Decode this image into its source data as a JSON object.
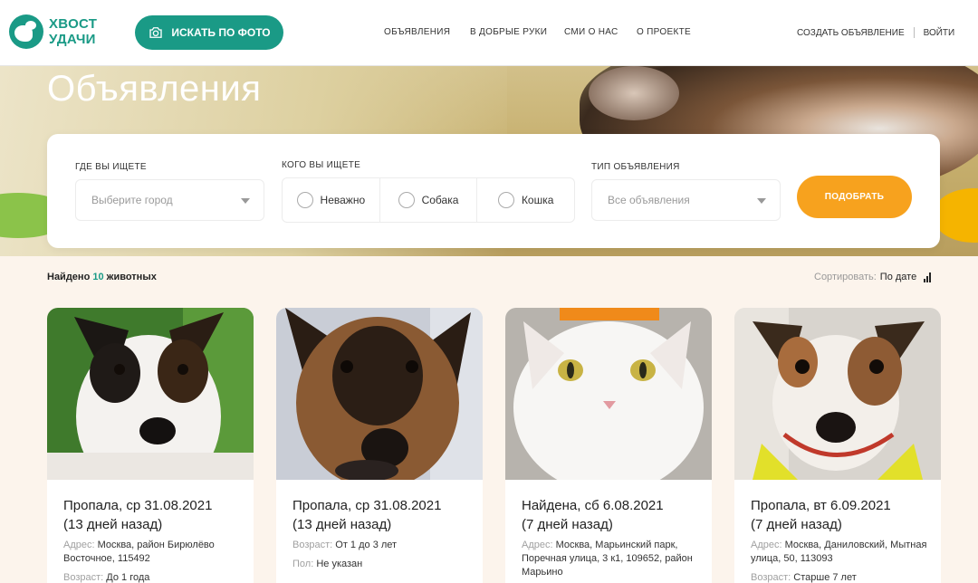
{
  "header": {
    "logo_line1": "ХВОСТ",
    "logo_line2": "УДАЧИ",
    "photo_button": "ИСКАТЬ ПО ФОТО",
    "nav": [
      "ОБЪЯВЛЕНИЯ",
      "В ДОБРЫЕ РУКИ",
      "СМИ О НАС",
      "О ПРОЕКТЕ"
    ],
    "create_ad": "СОЗДАТЬ ОБЪЯВЛЕНИЕ",
    "login": "ВОЙТИ"
  },
  "hero": {
    "title": "Объявления"
  },
  "filter": {
    "where_label": "ГДЕ ВЫ ИЩЕТЕ",
    "city_placeholder": "Выберите город",
    "who_label": "КОГО ВЫ ИЩЕТЕ",
    "who_options": [
      "Неважно",
      "Собака",
      "Кошка"
    ],
    "type_label": "ТИП ОБЪЯВЛЕНИЯ",
    "type_value": "Все объявления",
    "submit": "ПОДОБРАТЬ"
  },
  "results": {
    "found_prefix": "Найдено",
    "found_count": "10",
    "found_suffix": "животных",
    "sort_label": "Сортировать:",
    "sort_value": "По дате"
  },
  "cards": [
    {
      "title_line1": "Пропала, ср 31.08.2021",
      "title_line2": "(13 дней назад)",
      "rows": [
        {
          "key": "Адрес:",
          "value": "Москва, район Бирюлёво Восточное, 115492"
        },
        {
          "key": "Возраст:",
          "value": "До 1 года"
        }
      ]
    },
    {
      "title_line1": "Пропала, ср 31.08.2021",
      "title_line2": "(13 дней назад)",
      "rows": [
        {
          "key": "Возраст:",
          "value": "От 1 до 3 лет"
        },
        {
          "key": "Пол:",
          "value": "Не указан"
        }
      ]
    },
    {
      "title_line1": "Найдена, сб 6.08.2021",
      "title_line2": "(7 дней назад)",
      "rows": [
        {
          "key": "Адрес:",
          "value": "Москва, Марьинский парк, Поречная улица, 3 к1, 109652, район Марьино"
        }
      ]
    },
    {
      "title_line1": "Пропала, вт 6.09.2021",
      "title_line2": "(7 дней назад)",
      "rows": [
        {
          "key": "Адрес:",
          "value": "Москва, Даниловский, Мытная улица, 50, 113093"
        },
        {
          "key": "Возраст:",
          "value": "Старше 7 лет"
        }
      ]
    }
  ],
  "colors": {
    "brand": "#1a9a86",
    "accent": "#f7a21e",
    "page_bg": "#fcf4ec"
  }
}
